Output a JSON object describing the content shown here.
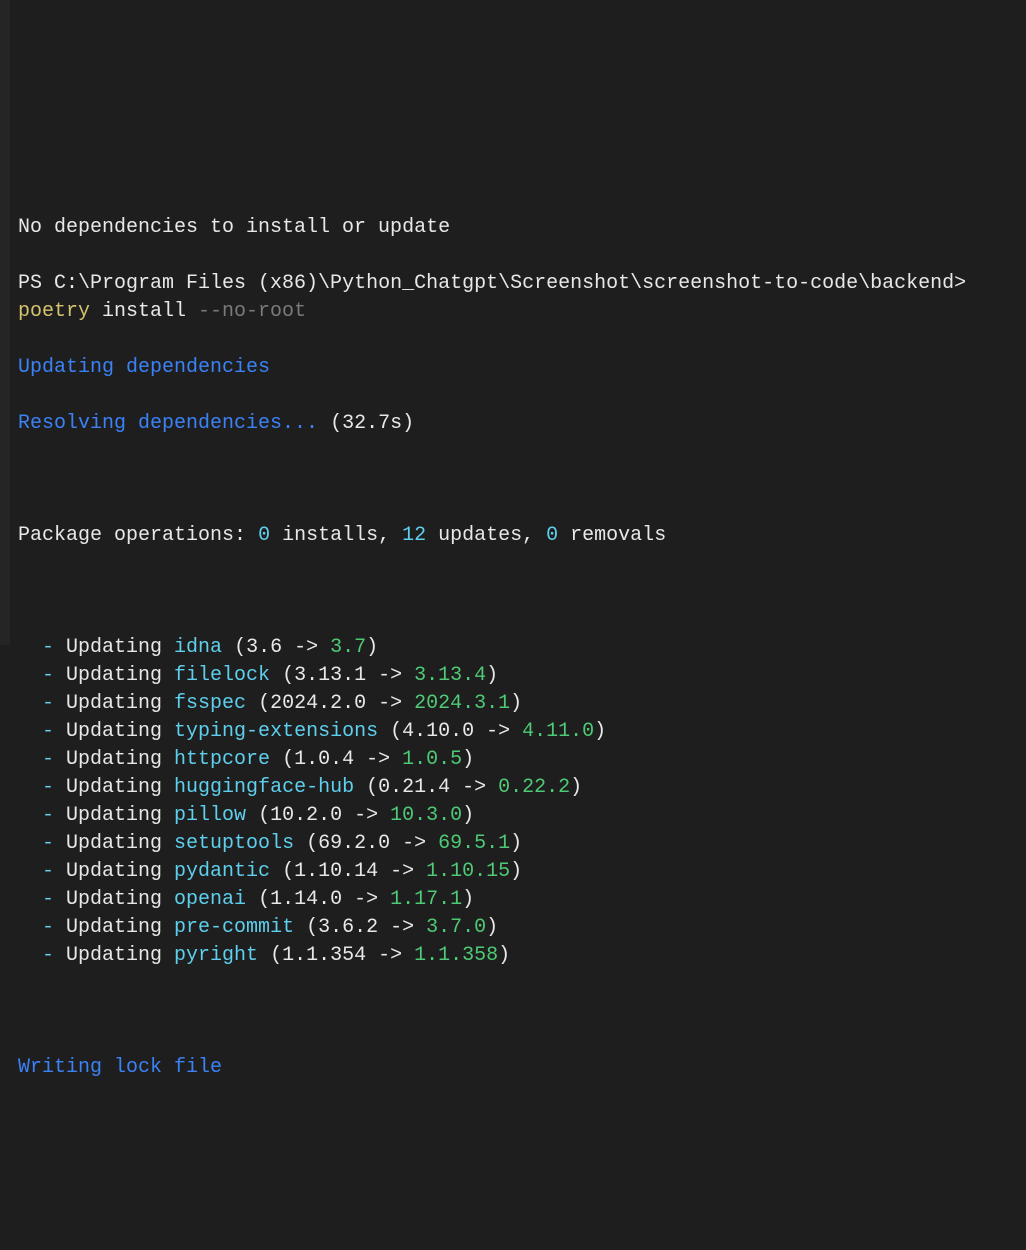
{
  "prior_output": "No dependencies to install or update",
  "prompt": {
    "prefix": "PS ",
    "path": "C:\\Program Files (x86)\\Python_Chatgpt\\Screenshot\\screenshot-to-code\\backend",
    "caret": "> ",
    "cmd_keyword": "poetry",
    "cmd_rest": " install ",
    "cmd_flag": "--no-root"
  },
  "updating_deps": "Updating dependencies",
  "resolving_deps": "Resolving dependencies...",
  "resolving_time": " (32.7s)",
  "pkg_ops": {
    "label": "Package operations",
    "sep": ": ",
    "installs_n": "0",
    "installs_t": " installs, ",
    "updates_n": "12",
    "updates_t": " updates, ",
    "removals_n": "0",
    "removals_t": " removals"
  },
  "bullet": "-",
  "updating_word": " Updating ",
  "arrow": " -> ",
  "updates": [
    {
      "name": "idna",
      "from": "3.6",
      "to": "3.7"
    },
    {
      "name": "filelock",
      "from": "3.13.1",
      "to": "3.13.4"
    },
    {
      "name": "fsspec",
      "from": "2024.2.0",
      "to": "2024.3.1"
    },
    {
      "name": "typing-extensions",
      "from": "4.10.0",
      "to": "4.11.0"
    },
    {
      "name": "httpcore",
      "from": "1.0.4",
      "to": "1.0.5"
    },
    {
      "name": "huggingface-hub",
      "from": "0.21.4",
      "to": "0.22.2"
    },
    {
      "name": "pillow",
      "from": "10.2.0",
      "to": "10.3.0"
    },
    {
      "name": "setuptools",
      "from": "69.2.0",
      "to": "69.5.1"
    },
    {
      "name": "pydantic",
      "from": "1.10.14",
      "to": "1.10.15"
    },
    {
      "name": "openai",
      "from": "1.14.0",
      "to": "1.17.1"
    },
    {
      "name": "pre-commit",
      "from": "3.6.2",
      "to": "3.7.0"
    },
    {
      "name": "pyright",
      "from": "1.1.354",
      "to": "1.1.358"
    }
  ],
  "writing_lock": "Writing lock file"
}
